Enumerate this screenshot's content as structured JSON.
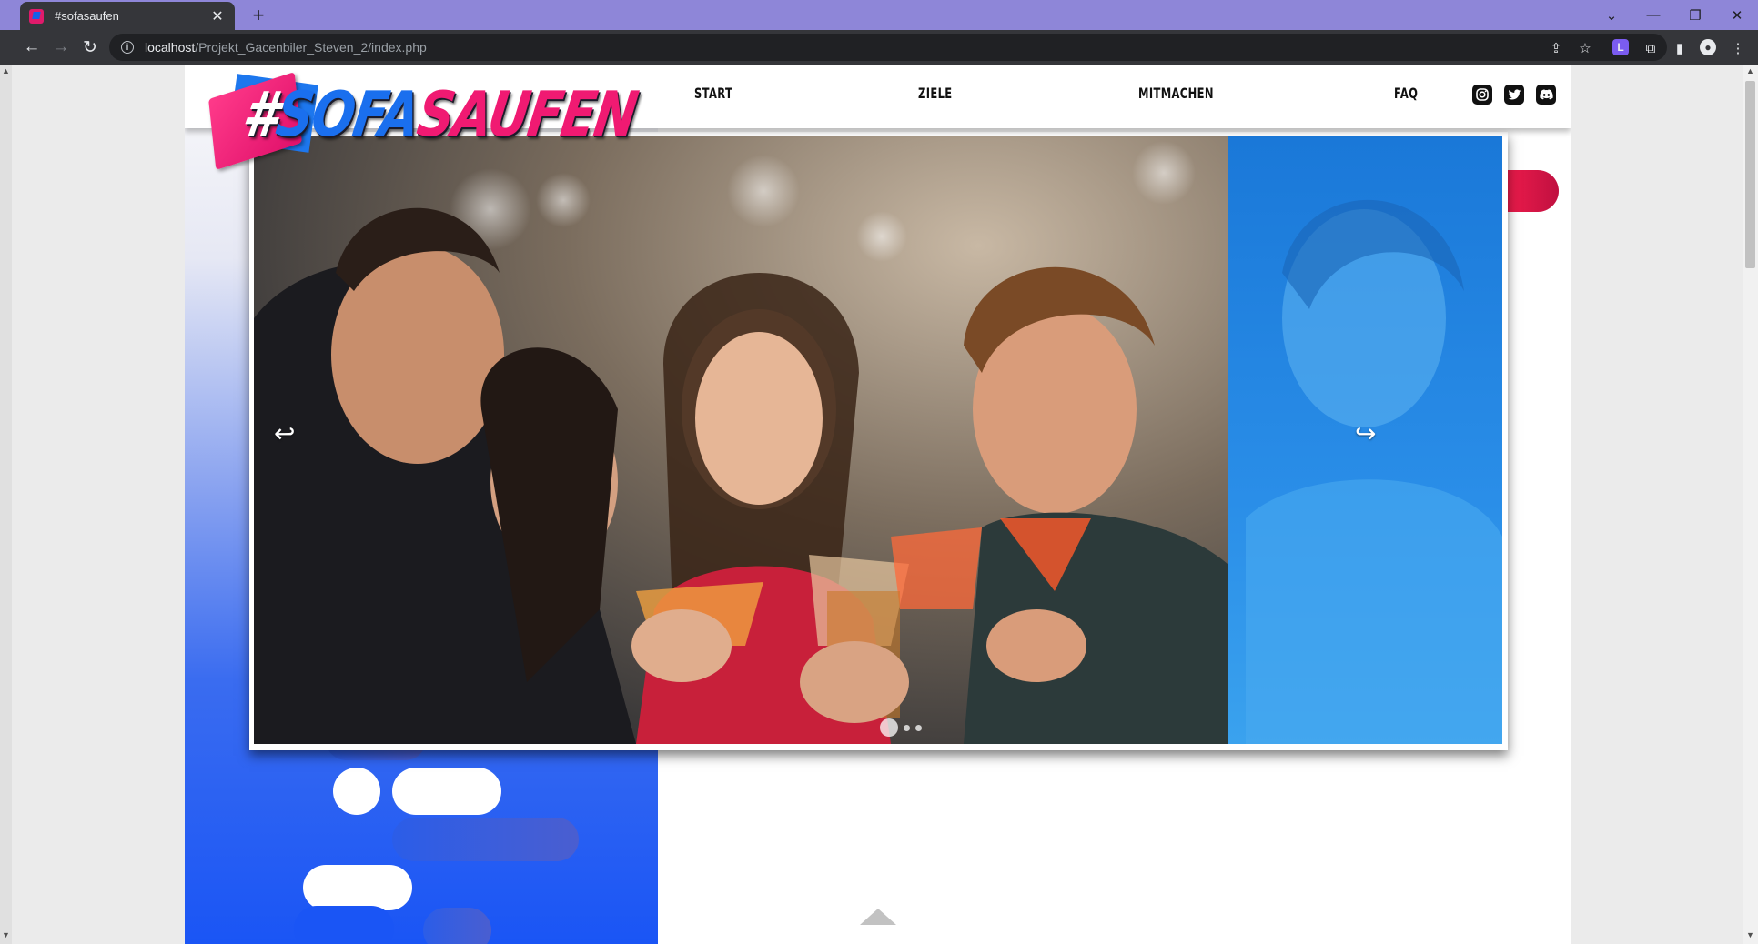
{
  "browser": {
    "tab_title": "#sofasaufen",
    "new_tab": "+",
    "url_host": "localhost",
    "url_path": "/Projekt_Gacenbiler_Steven_2/index.php",
    "extension_badge": "L"
  },
  "site": {
    "logo": {
      "hash": "#",
      "part1": "SOFA",
      "part2": "SAUFEN"
    },
    "nav": [
      "START",
      "ZIELE",
      "MITMACHEN",
      "FAQ"
    ],
    "social": [
      "instagram-icon",
      "twitter-icon",
      "discord-icon"
    ]
  },
  "slider": {
    "prev_glyph": "↩",
    "next_glyph": "↪",
    "slide_count": 3,
    "active_slide": 1
  },
  "colors": {
    "tab_strip": "#8e86d8",
    "brand_pink": "#f01a72",
    "brand_blue": "#1a6fee",
    "accent_red": "#e01a4a"
  }
}
